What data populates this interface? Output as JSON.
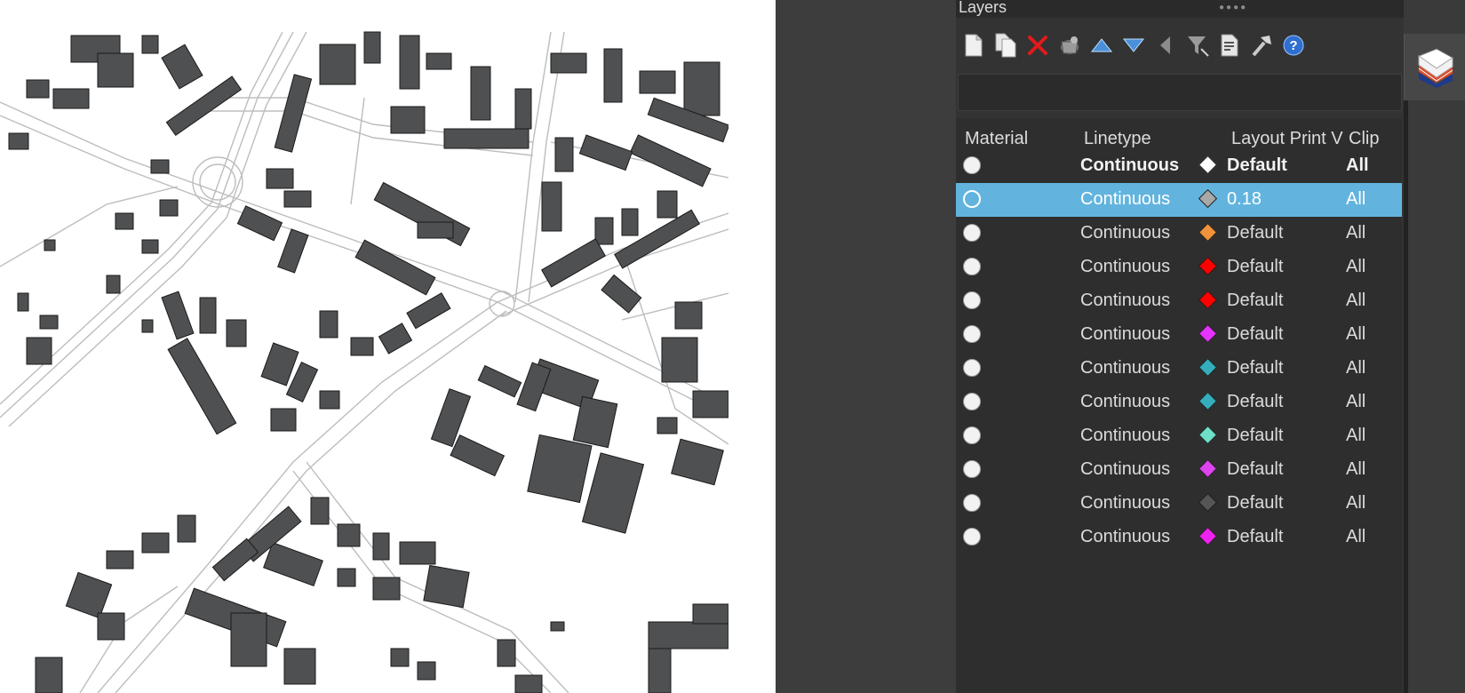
{
  "panel": {
    "title": "Layers"
  },
  "toolbar": [
    {
      "name": "new-layer-icon"
    },
    {
      "name": "duplicate-layer-icon"
    },
    {
      "name": "delete-layer-icon"
    },
    {
      "name": "purge-icon"
    },
    {
      "name": "move-up-icon"
    },
    {
      "name": "move-down-icon"
    },
    {
      "name": "collapse-icon"
    },
    {
      "name": "filter-icon"
    },
    {
      "name": "properties-icon"
    },
    {
      "name": "tools-icon"
    },
    {
      "name": "help-icon"
    }
  ],
  "columns": {
    "material": "Material",
    "linetype": "Linetype",
    "layout_print": "Layout Print V",
    "clip": "Clip"
  },
  "rows": [
    {
      "linetype": "Continuous",
      "color": "#ffffff",
      "print_width": "Default",
      "clip": "All",
      "bold": true,
      "selected": false
    },
    {
      "linetype": "Continuous",
      "color": "#a8a8a8",
      "print_width": "0.18",
      "clip": "All",
      "bold": false,
      "selected": true
    },
    {
      "linetype": "Continuous",
      "color": "#f0933a",
      "print_width": "Default",
      "clip": "All",
      "bold": false,
      "selected": false
    },
    {
      "linetype": "Continuous",
      "color": "#ff0000",
      "print_width": "Default",
      "clip": "All",
      "bold": false,
      "selected": false
    },
    {
      "linetype": "Continuous",
      "color": "#ff0000",
      "print_width": "Default",
      "clip": "All",
      "bold": false,
      "selected": false
    },
    {
      "linetype": "Continuous",
      "color": "#e633ff",
      "print_width": "Default",
      "clip": "All",
      "bold": false,
      "selected": false
    },
    {
      "linetype": "Continuous",
      "color": "#34aebc",
      "print_width": "Default",
      "clip": "All",
      "bold": false,
      "selected": false
    },
    {
      "linetype": "Continuous",
      "color": "#34aebc",
      "print_width": "Default",
      "clip": "All",
      "bold": false,
      "selected": false
    },
    {
      "linetype": "Continuous",
      "color": "#6ee0c8",
      "print_width": "Default",
      "clip": "All",
      "bold": false,
      "selected": false
    },
    {
      "linetype": "Continuous",
      "color": "#dd44ee",
      "print_width": "Default",
      "clip": "All",
      "bold": false,
      "selected": false
    },
    {
      "linetype": "Continuous",
      "color": "#555555",
      "print_width": "Default",
      "clip": "All",
      "bold": false,
      "selected": false
    },
    {
      "linetype": "Continuous",
      "color": "#ee22ee",
      "print_width": "Default",
      "clip": "All",
      "bold": false,
      "selected": false
    }
  ],
  "colors": {
    "building": "#4f5052",
    "road_line": "#bdbdbd",
    "selected_row": "#62b4de"
  }
}
